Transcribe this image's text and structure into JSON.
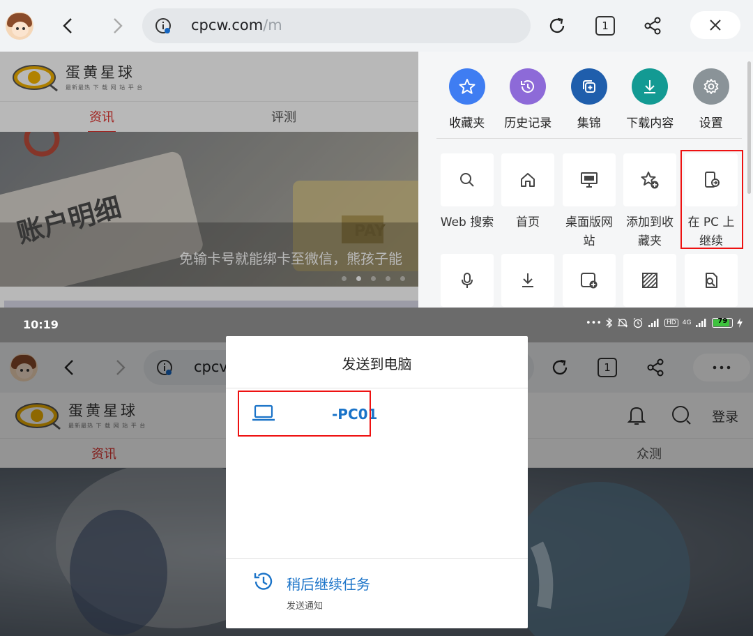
{
  "top": {
    "url": {
      "host": "cpcw.com",
      "path": "/m"
    },
    "tab_count": "1",
    "site": {
      "logo_title": "蛋黄星球",
      "logo_subtitle": "最新最热 下 载 网 站 平 台",
      "tabs": [
        "资讯",
        "评测"
      ],
      "banner_caption": "免输卡号就能绑卡至微信，熊孩子能",
      "banner_words": [
        "账户明细",
        "PAY"
      ]
    },
    "menu": {
      "quick_actions": [
        {
          "label": "收藏夹",
          "icon": "star-icon",
          "color": "#3f7df2"
        },
        {
          "label": "历史记录",
          "icon": "history-icon",
          "color": "#8d6ad8"
        },
        {
          "label": "集锦",
          "icon": "collections-icon",
          "color": "#1f5eac"
        },
        {
          "label": "下载内容",
          "icon": "download-icon",
          "color": "#139a93"
        },
        {
          "label": "设置",
          "icon": "gear-icon",
          "color": "#8a9398"
        }
      ],
      "tiles": [
        {
          "label": "Web 搜索",
          "icon": "search-icon"
        },
        {
          "label": "首页",
          "icon": "home-icon"
        },
        {
          "label": "桌面版网站",
          "icon": "desktop-icon"
        },
        {
          "label": "添加到收藏夹",
          "icon": "add-favorite-icon"
        },
        {
          "label": "在 PC 上继续",
          "icon": "continue-on-pc-icon"
        }
      ],
      "tiles_row2_icons": [
        "microphone-icon",
        "download-icon",
        "add-tab-icon",
        "pattern-icon",
        "search-page-icon"
      ]
    }
  },
  "bottom": {
    "status": {
      "time": "10:19",
      "battery": "79",
      "network": "4G"
    },
    "url_partial": "cpcv",
    "tab_count": "1",
    "site": {
      "logo_title": "蛋黄星球",
      "logo_subtitle": "最新最热 下 载 网 站 平 台",
      "login": "登录",
      "tabs": [
        "资讯",
        "众测"
      ]
    },
    "dialog": {
      "title": "发送到电脑",
      "device_name": "-PC01",
      "later_title": "稍后继续任务",
      "later_subtitle": "发送通知"
    }
  },
  "colors": {
    "highlight": "#e11111",
    "accent_red": "#e0322f",
    "link_blue": "#1a73c8"
  }
}
